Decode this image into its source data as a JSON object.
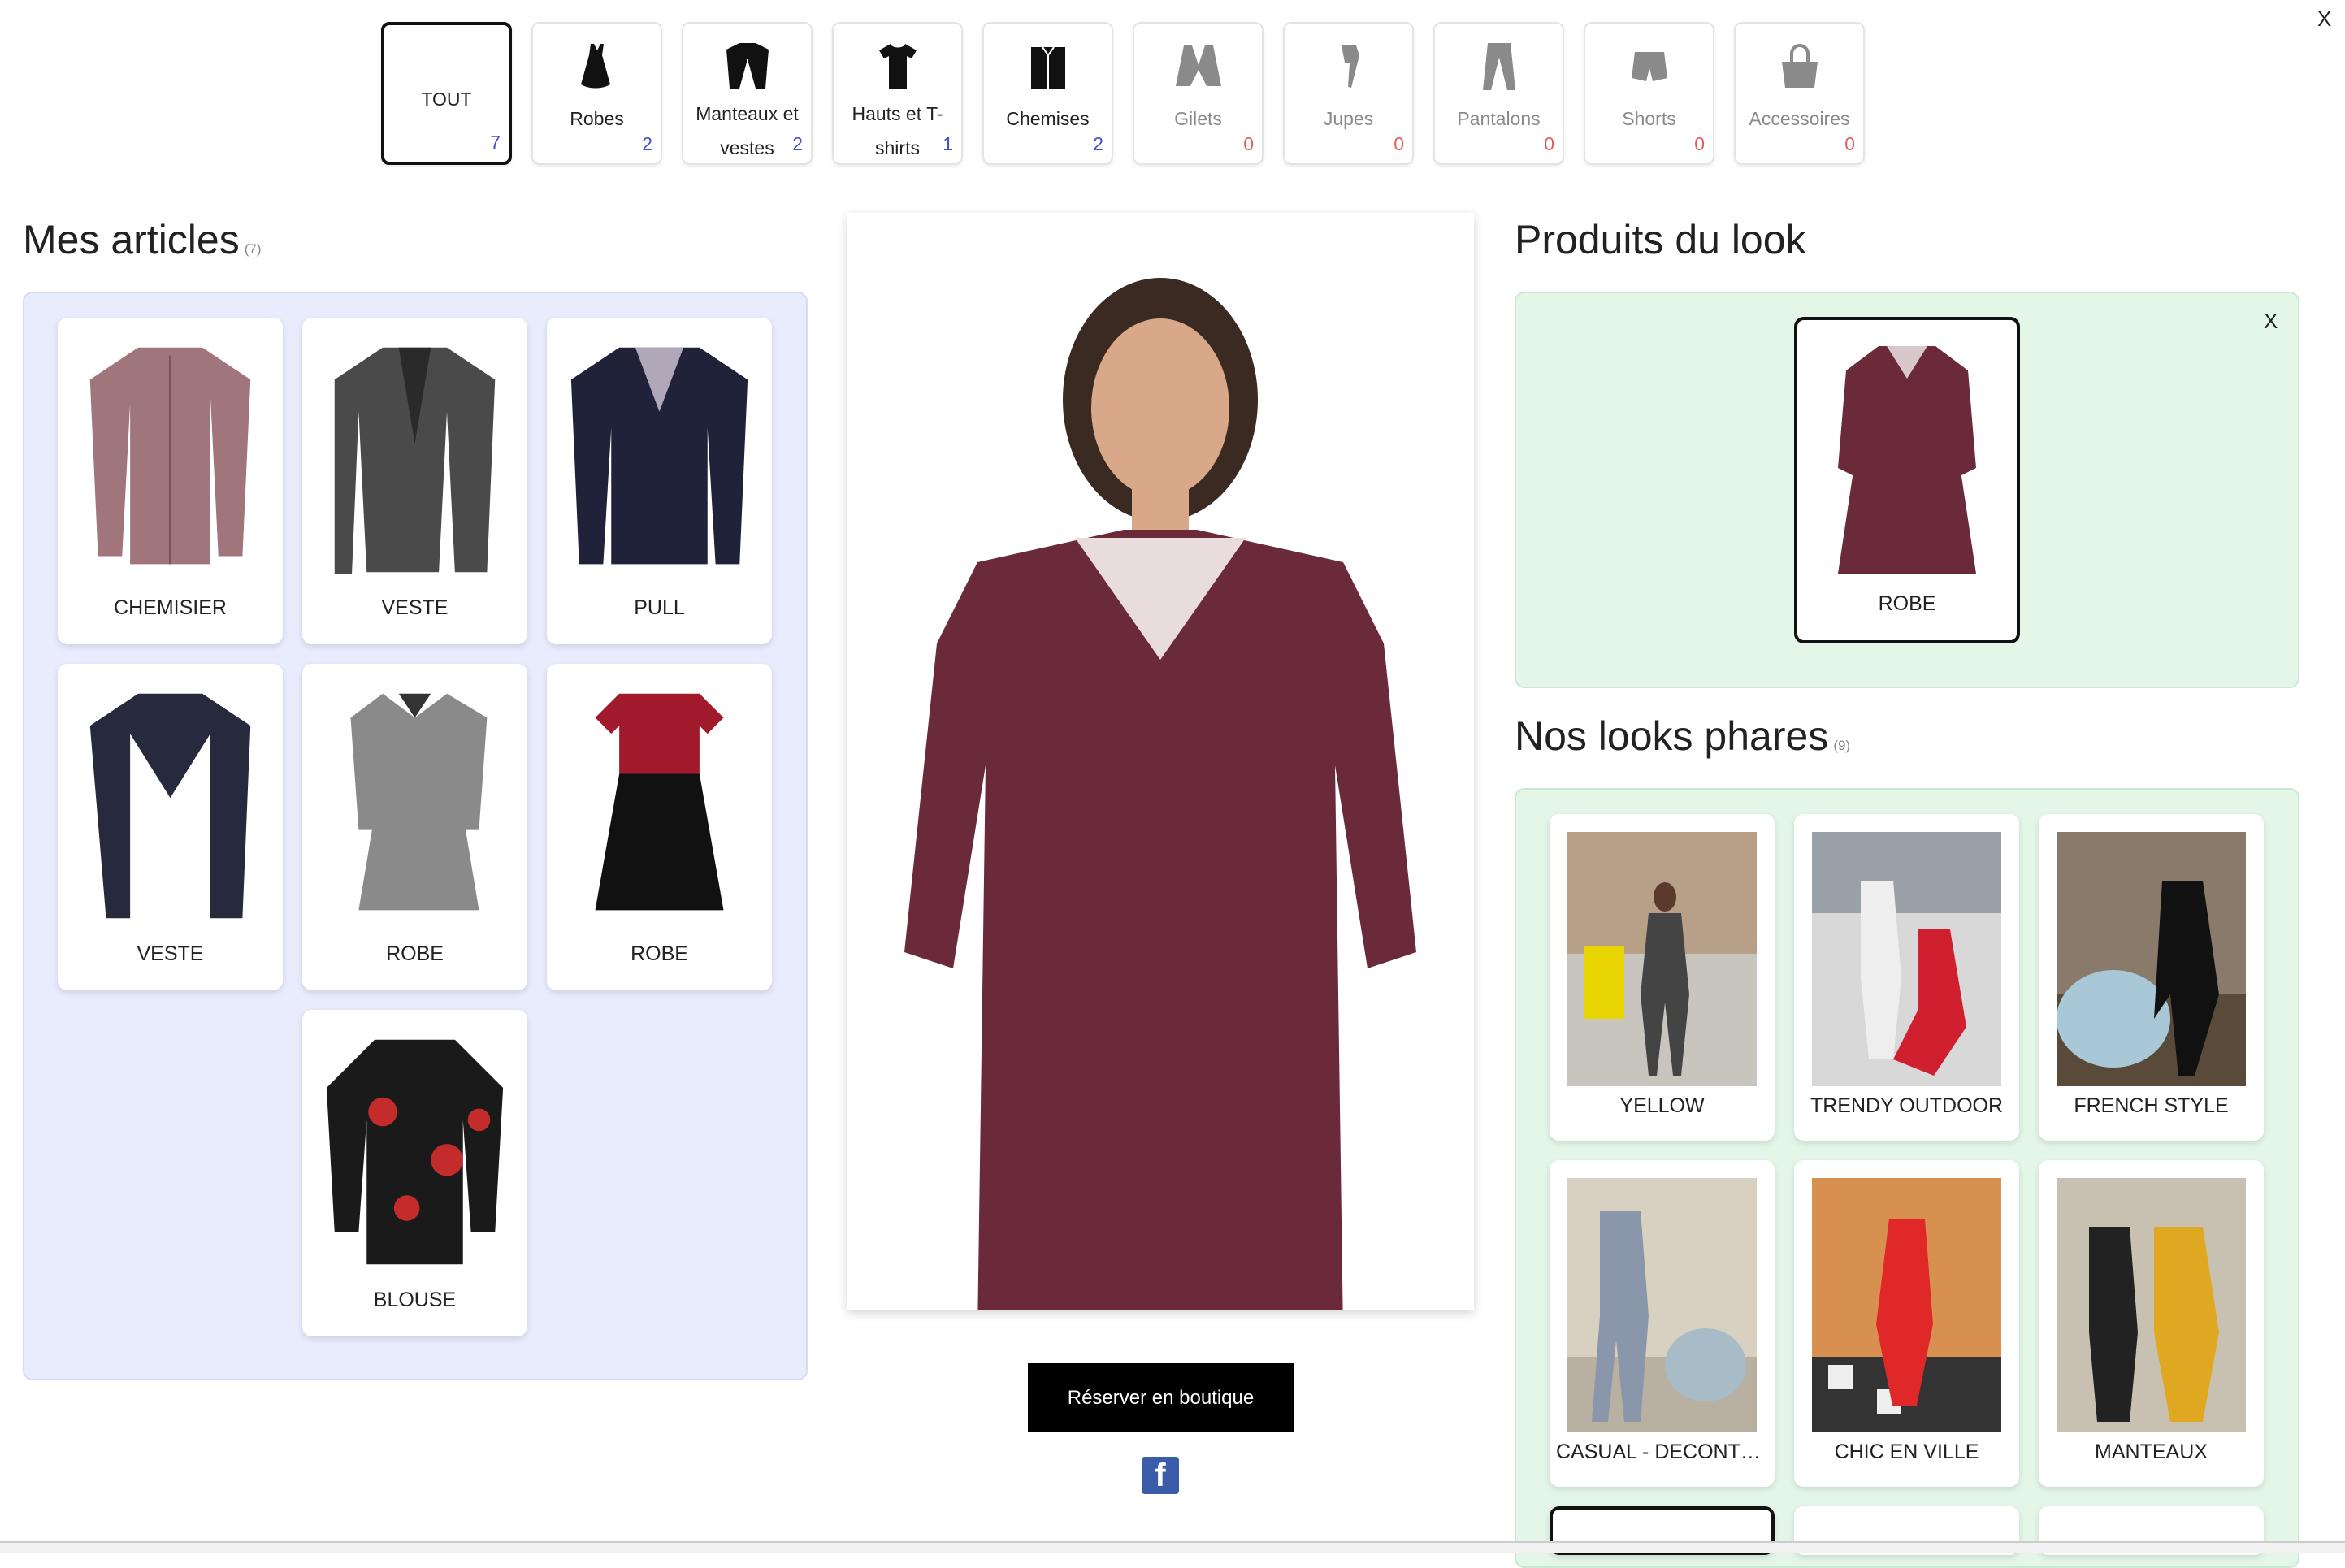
{
  "close_label": "X",
  "categories": [
    {
      "label": "TOUT",
      "count": "7",
      "active": true
    },
    {
      "label": "Robes",
      "count": "2"
    },
    {
      "label": "Manteaux et vestes",
      "count": "2"
    },
    {
      "label": "Hauts et T-shirts",
      "count": "1"
    },
    {
      "label": "Chemises",
      "count": "2"
    },
    {
      "label": "Gilets",
      "count": "0"
    },
    {
      "label": "Jupes",
      "count": "0"
    },
    {
      "label": "Pantalons",
      "count": "0"
    },
    {
      "label": "Shorts",
      "count": "0"
    },
    {
      "label": "Accessoires",
      "count": "0"
    }
  ],
  "articles": {
    "title": "Mes articles",
    "count": "(7)",
    "items": [
      {
        "label": "CHEMISIER",
        "icon": "blouse-pink-icon"
      },
      {
        "label": "VESTE",
        "icon": "jacket-grey-icon"
      },
      {
        "label": "PULL",
        "icon": "cardigan-navy-icon"
      },
      {
        "label": "VESTE",
        "icon": "blazer-navy-icon"
      },
      {
        "label": "ROBE",
        "icon": "dress-leopard-icon"
      },
      {
        "label": "ROBE",
        "icon": "dress-red-black-icon"
      },
      {
        "label": "BLOUSE",
        "icon": "blouse-floral-icon"
      }
    ]
  },
  "main": {
    "reserve_label": "Réserver en boutique",
    "facebook_label": "f"
  },
  "look_products": {
    "title": "Produits du look",
    "close_label": "X",
    "item_label": "ROBE"
  },
  "looks": {
    "title": "Nos looks phares",
    "count": "(9)",
    "items": [
      {
        "label": "YELLOW"
      },
      {
        "label": "TRENDY OUTDOOR"
      },
      {
        "label": "FRENCH STYLE"
      },
      {
        "label": "CASUAL - DECONTRACTE"
      },
      {
        "label": "CHIC EN VILLE"
      },
      {
        "label": "MANTEAUX"
      }
    ]
  },
  "colors": {
    "articles_bg": "#e8ecfd",
    "looks_bg": "#e4f6e8",
    "count_blue": "#4a4ec7",
    "count_red": "#e35d5d",
    "dress": "#6b2a3a"
  }
}
